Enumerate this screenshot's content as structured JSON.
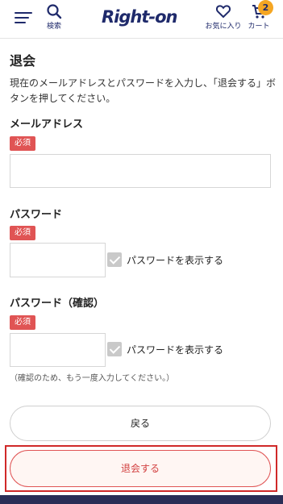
{
  "header": {
    "logo": "Right-on",
    "search_label": "検索",
    "favorites_label": "お気に入り",
    "cart_label": "カート",
    "cart_count": "2",
    "menu_icon": "hamburger-icon",
    "search_icon": "search-icon",
    "favorites_icon": "heart-icon",
    "cart_icon": "cart-icon",
    "brand_color": "#1f2a6b",
    "badge_color": "#f5a623"
  },
  "page": {
    "title": "退会",
    "description": "現在のメールアドレスとパスワードを入力し、「退会する」ボタンを押してください。"
  },
  "form": {
    "required_label": "必須",
    "email": {
      "label": "メールアドレス",
      "value": ""
    },
    "password": {
      "label": "パスワード",
      "value": "",
      "show_label": "パスワードを表示する",
      "show_checked": true
    },
    "password_confirm": {
      "label": "パスワード（確認）",
      "value": "",
      "show_label": "パスワードを表示する",
      "show_checked": true,
      "note": "（確認のため、もう一度入力してください。）"
    }
  },
  "buttons": {
    "back_label": "戻る",
    "withdraw_label": "退会する",
    "withdraw_color": "#d24040"
  }
}
